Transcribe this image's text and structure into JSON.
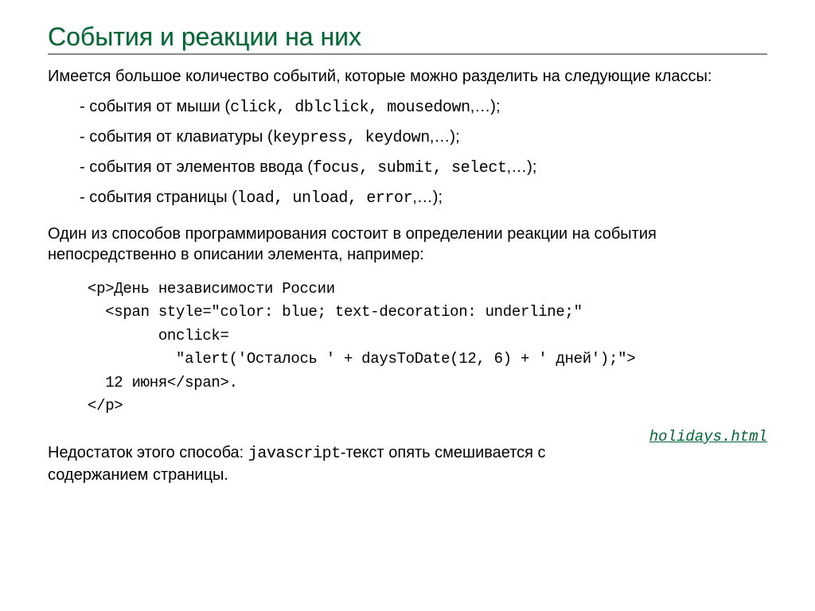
{
  "title": "События и реакции на них",
  "intro": "Имеется большое количество событий, которые можно разделить на следующие классы:",
  "bullets": [
    {
      "prefix": "- события от мыши (",
      "mono": "click, dblclick, mousedown",
      "suffix": ",…);"
    },
    {
      "prefix": "- события от клавиатуры (",
      "mono": "keypress, keydown",
      "suffix": ",…);"
    },
    {
      "prefix": "- события от элементов ввода (",
      "mono": "focus, submit, select",
      "suffix": ",…);"
    },
    {
      "prefix": "- события страницы (",
      "mono": "load, unload, error",
      "suffix": ",…);"
    }
  ],
  "para2": "Один из способов программирования состоит в определении реакции на события непосредственно в описании элемента, например:",
  "code": "<p>День независимости России\n  <span style=\"color: blue; text-decoration: underline;\"\n        onclick=\n          \"alert('Осталось ' + daysToDate(12, 6) + ' дней');\">\n  12 июня</span>.\n</p>",
  "drawback_pre": "Недостаток этого способа: ",
  "drawback_mono": "javascript",
  "drawback_post": "-текст опять смешивается с содержанием страницы.",
  "link_label": "holidays.html"
}
